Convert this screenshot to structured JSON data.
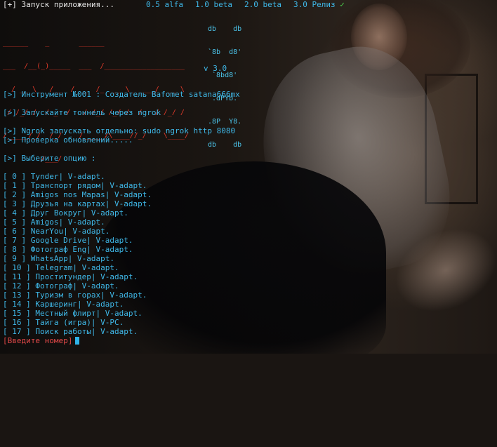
{
  "header": {
    "prefix": "[+]",
    "title": "Запуск приложения...",
    "versions": [
      "0.5 alfa",
      "1.0 beta",
      "2.0 beta",
      "3.0 Релиз"
    ],
    "check": "✓"
  },
  "logo": {
    "red_art": [
      "______    _       ______",
      "___  /__(_)_____  ___  /___________________",
      "  / __ \\_  /__  /  _  /_  __ \\_  ___/  __ \\",
      " / /_/ /  / _  /   / /_/ /_/ /  /   / /_/ /",
      "/_____/_/  /_/    /_____/\\____//_/    \\____/",
      "         /___/"
    ],
    "cyan_art": [
      "db    db",
      "`8b  d8'",
      " `8bd8'",
      " .dPYb.",
      ".8P  Y8.",
      "db    db"
    ],
    "version": "v 3.0"
  },
  "messages": [
    {
      "prefix": "[>]",
      "text": "Инструмент №001 : Создатель Bafomet satana666mx"
    },
    {
      "prefix": "[>]",
      "text": "Запускайте тоннель через ngrok"
    },
    {
      "prefix": "[>]",
      "text": "Ngrok запускать отдельно: sudo ngrok http 8080"
    },
    {
      "prefix": "[>]",
      "text": "Проверка обновлений....."
    },
    {
      "prefix": "[>]",
      "text": "Выберите опцию :"
    }
  ],
  "options": [
    {
      "num": "[ 0 ]",
      "label": "Tynder| V-adapt."
    },
    {
      "num": "[ 1 ]",
      "label": "Транспорт рядом| V-adapt."
    },
    {
      "num": "[ 2 ]",
      "label": "Amigos nos Mapas| V-adapt."
    },
    {
      "num": "[ 3 ]",
      "label": "Друзья на картах| V-adapt."
    },
    {
      "num": "[ 4 ]",
      "label": "Друг Вокруг| V-adapt."
    },
    {
      "num": "[ 5 ]",
      "label": "Amigos| V-adapt."
    },
    {
      "num": "[ 6 ]",
      "label": "NearYou| V-adapt."
    },
    {
      "num": "[ 7 ]",
      "label": "Google Drive| V-adapt."
    },
    {
      "num": "[ 8 ]",
      "label": "Фотограф Eng| V-adapt."
    },
    {
      "num": "[ 9 ]",
      "label": "WhatsApp| V-adapt."
    },
    {
      "num": "[ 10 ]",
      "label": "Telegram| V-adapt."
    },
    {
      "num": "[ 11 ]",
      "label": "Проститундер| V-adapt."
    },
    {
      "num": "[ 12 ]",
      "label": "Фотограф| V-adapt."
    },
    {
      "num": "[ 13 ]",
      "label": "Туризм в горах| V-adapt."
    },
    {
      "num": "[ 14 ]",
      "label": "Каршеринг| V-adapt."
    },
    {
      "num": "[ 15 ]",
      "label": "Местный флирт| V-adapt."
    },
    {
      "num": "[ 16 ]",
      "label": "Тайга (игра)| V-PC."
    },
    {
      "num": "[ 17 ]",
      "label": "Поиск работы| V-adapt."
    }
  ],
  "prompt": "[Введите номер]",
  "colors": {
    "accent": "#3fb8e8",
    "prompt": "#e04848",
    "logo": "#e23a2a",
    "check": "#4bd04b"
  }
}
